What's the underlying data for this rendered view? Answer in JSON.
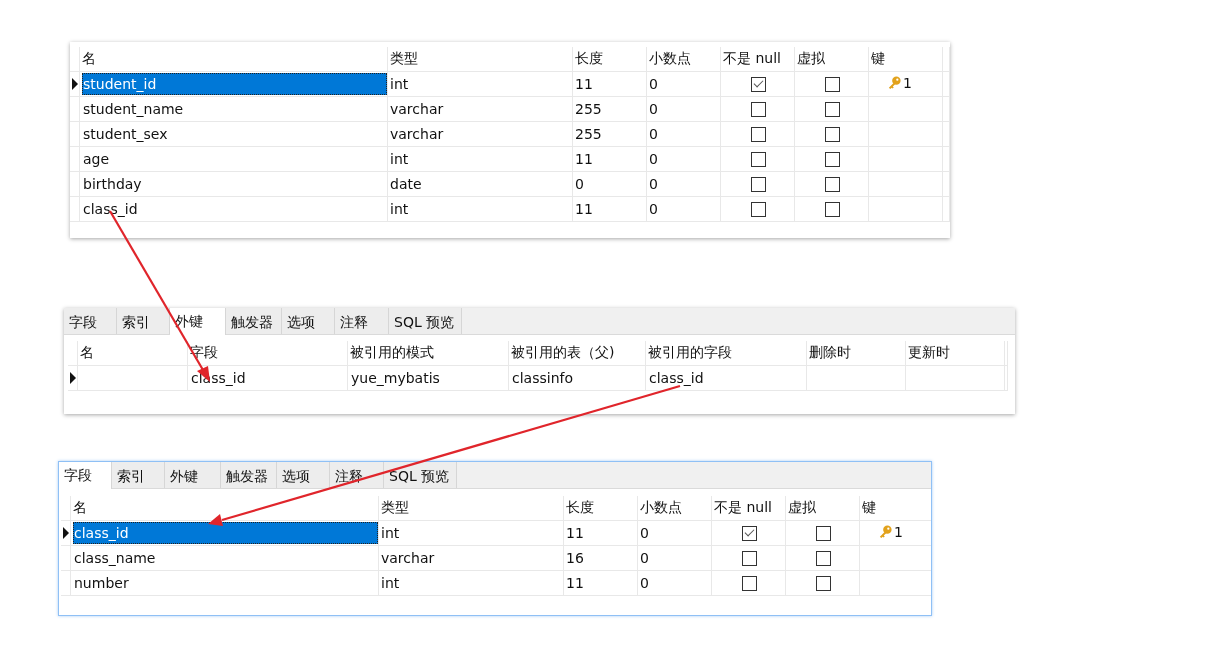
{
  "panels": [
    {
      "kind": "fields",
      "focused": false,
      "columns": [
        "名",
        "类型",
        "长度",
        "小数点",
        "不是 null",
        "虚拟",
        "键"
      ],
      "rows": [
        {
          "name": "student_id",
          "type": "int",
          "length": "11",
          "decimals": "0",
          "not_null": true,
          "virtual": false,
          "key": "1",
          "current": true,
          "selected": true
        },
        {
          "name": "student_name",
          "type": "varchar",
          "length": "255",
          "decimals": "0",
          "not_null": false,
          "virtual": false,
          "current": false,
          "selected": false
        },
        {
          "name": "student_sex",
          "type": "varchar",
          "length": "255",
          "decimals": "0",
          "not_null": false,
          "virtual": false,
          "current": false,
          "selected": false
        },
        {
          "name": "age",
          "type": "int",
          "length": "11",
          "decimals": "0",
          "not_null": false,
          "virtual": false,
          "current": false,
          "selected": false
        },
        {
          "name": "birthday",
          "type": "date",
          "length": "0",
          "decimals": "0",
          "not_null": false,
          "virtual": false,
          "current": false,
          "selected": false
        },
        {
          "name": "class_id",
          "type": "int",
          "length": "11",
          "decimals": "0",
          "not_null": false,
          "virtual": false,
          "current": false,
          "selected": false
        }
      ]
    },
    {
      "kind": "foreign_keys",
      "focused": false,
      "tabs": [
        {
          "label": "字段",
          "selected": false
        },
        {
          "label": "索引",
          "selected": false
        },
        {
          "label": "外键",
          "selected": true
        },
        {
          "label": "触发器",
          "selected": false
        },
        {
          "label": "选项",
          "selected": false
        },
        {
          "label": "注释",
          "selected": false
        },
        {
          "label": "SQL 预览",
          "selected": false
        }
      ],
      "columns": [
        "名",
        "字段",
        "被引用的模式",
        "被引用的表（父)",
        "被引用的字段",
        "删除时",
        "更新时"
      ],
      "rows": [
        {
          "field": "class_id",
          "ref_schema": "yue_mybatis",
          "ref_table": "classinfo",
          "ref_field": "class_id",
          "current": true
        }
      ]
    },
    {
      "kind": "fields",
      "focused": true,
      "tabs": [
        {
          "label": "字段",
          "selected": true
        },
        {
          "label": "索引",
          "selected": false
        },
        {
          "label": "外键",
          "selected": false
        },
        {
          "label": "触发器",
          "selected": false
        },
        {
          "label": "选项",
          "selected": false
        },
        {
          "label": "注释",
          "selected": false
        },
        {
          "label": "SQL 预览",
          "selected": false
        }
      ],
      "columns": [
        "名",
        "类型",
        "长度",
        "小数点",
        "不是 null",
        "虚拟",
        "键"
      ],
      "rows": [
        {
          "name": "class_id",
          "type": "int",
          "length": "11",
          "decimals": "0",
          "not_null": true,
          "virtual": false,
          "key": "1",
          "current": true,
          "selected": true
        },
        {
          "name": "class_name",
          "type": "varchar",
          "length": "16",
          "decimals": "0",
          "not_null": false,
          "virtual": false,
          "current": false,
          "selected": false
        },
        {
          "name": "number",
          "type": "int",
          "length": "11",
          "decimals": "0",
          "not_null": false,
          "virtual": false,
          "current": false,
          "selected": false
        }
      ]
    }
  ]
}
